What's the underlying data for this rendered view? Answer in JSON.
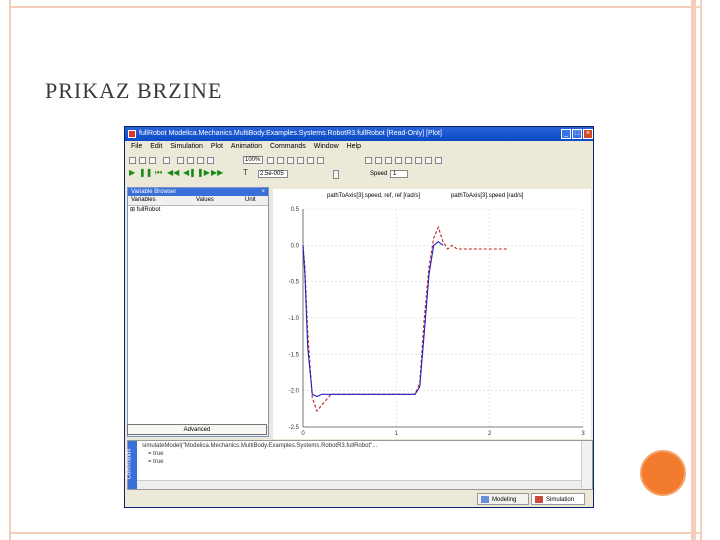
{
  "slide": {
    "title": "PRIKAZ BRZINE"
  },
  "window": {
    "title": "fullRobot  Modelica.Mechanics.MultiBody.Examples.Systems.RobotR3.fullRobot  [Read-Only]  [Plot]",
    "menu": [
      "File",
      "Edit",
      "Simulation",
      "Plot",
      "Animation",
      "Commands",
      "Window",
      "Help"
    ],
    "zoom": "100%",
    "time_value": "2.5e-005",
    "speed_label": "Speed",
    "speed_value": "1",
    "colors": {
      "titlebar": "#0a4bc6",
      "panel_title": "#3b6fd8",
      "series_1": "#2020c0",
      "series_2": "#c02020"
    }
  },
  "variable_browser": {
    "title": "Variable Browser",
    "columns": [
      "Variables",
      "Values",
      "Unit"
    ],
    "rows": [
      "fullRobot"
    ],
    "advanced_button": "Advanced"
  },
  "commands": {
    "side_label": "Commands",
    "lines": [
      "simulateModel(\"Modelica.Mechanics.MultiBody.Examples.Systems.RobotR3.fullRobot\"...",
      "= true",
      "= true"
    ]
  },
  "tabs": {
    "modeling": "Modeling",
    "simulation": "Simulation"
  },
  "chart_data": {
    "type": "line",
    "title": "",
    "xlabel": "",
    "ylabel": "",
    "xlim": [
      0,
      3
    ],
    "ylim": [
      -2.5,
      0.5
    ],
    "x_ticks": [
      "0",
      "1",
      "2",
      "3"
    ],
    "y_ticks": [
      "0.5",
      "0.0",
      "-0.5",
      "-1.0",
      "-1.5",
      "-2.0",
      "-2.5"
    ],
    "grid": true,
    "legend_position": "top",
    "series": [
      {
        "name": "pathToAxis[3].speed, ref, ref [rad/s]",
        "style": "dashed",
        "x": [
          0.0,
          0.02,
          0.05,
          0.1,
          0.15,
          0.2,
          0.3,
          0.5,
          1.0,
          1.2,
          1.25,
          1.3,
          1.35,
          1.4,
          1.45,
          1.5,
          1.55,
          1.6,
          1.65,
          1.7,
          1.8,
          1.9,
          2.0,
          2.1,
          2.2
        ],
        "y": [
          0.0,
          -0.3,
          -1.2,
          -2.1,
          -2.28,
          -2.2,
          -2.05,
          -2.05,
          -2.05,
          -2.05,
          -1.9,
          -1.0,
          -0.3,
          0.1,
          0.25,
          0.05,
          -0.05,
          0.0,
          -0.05,
          -0.05,
          -0.05,
          -0.05,
          -0.05,
          -0.05,
          -0.05
        ]
      },
      {
        "name": "pathToAxis[3].speed [rad/s]",
        "style": "solid",
        "x": [
          0.0,
          0.02,
          0.05,
          0.1,
          0.15,
          0.2,
          0.3,
          0.5,
          1.0,
          1.2,
          1.25,
          1.3,
          1.35,
          1.4,
          1.45,
          1.5
        ],
        "y": [
          0.0,
          -0.4,
          -1.4,
          -2.05,
          -2.08,
          -2.05,
          -2.05,
          -2.05,
          -2.05,
          -2.05,
          -1.95,
          -1.2,
          -0.4,
          0.0,
          0.05,
          0.0
        ]
      }
    ]
  }
}
